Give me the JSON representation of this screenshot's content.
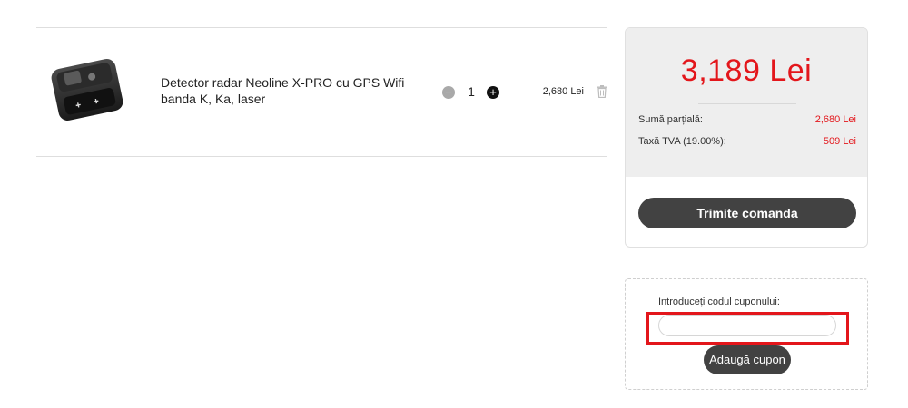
{
  "cart": {
    "items": [
      {
        "image_icon": "radar-detector-product-image",
        "name": "Detector radar Neoline X-PRO cu GPS Wifi banda K, Ka, laser",
        "quantity": "1",
        "minus_symbol": "−",
        "plus_symbol": "+",
        "price": "2,680 Lei",
        "remove_icon": "trash-icon"
      }
    ]
  },
  "summary": {
    "total": "3,189 Lei",
    "subtotal_label": "Sumă parțială:",
    "subtotal_value": "2,680 Lei",
    "tax_label": "Taxă TVA (19.00%):",
    "tax_value": "509 Lei",
    "submit_label": "Trimite comanda"
  },
  "coupon": {
    "label": "Introduceți codul cuponului:",
    "input_value": "",
    "input_placeholder": "",
    "button_label": "Adaugă cupon"
  },
  "colors": {
    "accent_red": "#e3161b",
    "button_dark": "#424242",
    "summary_bg": "#eeeeee"
  }
}
